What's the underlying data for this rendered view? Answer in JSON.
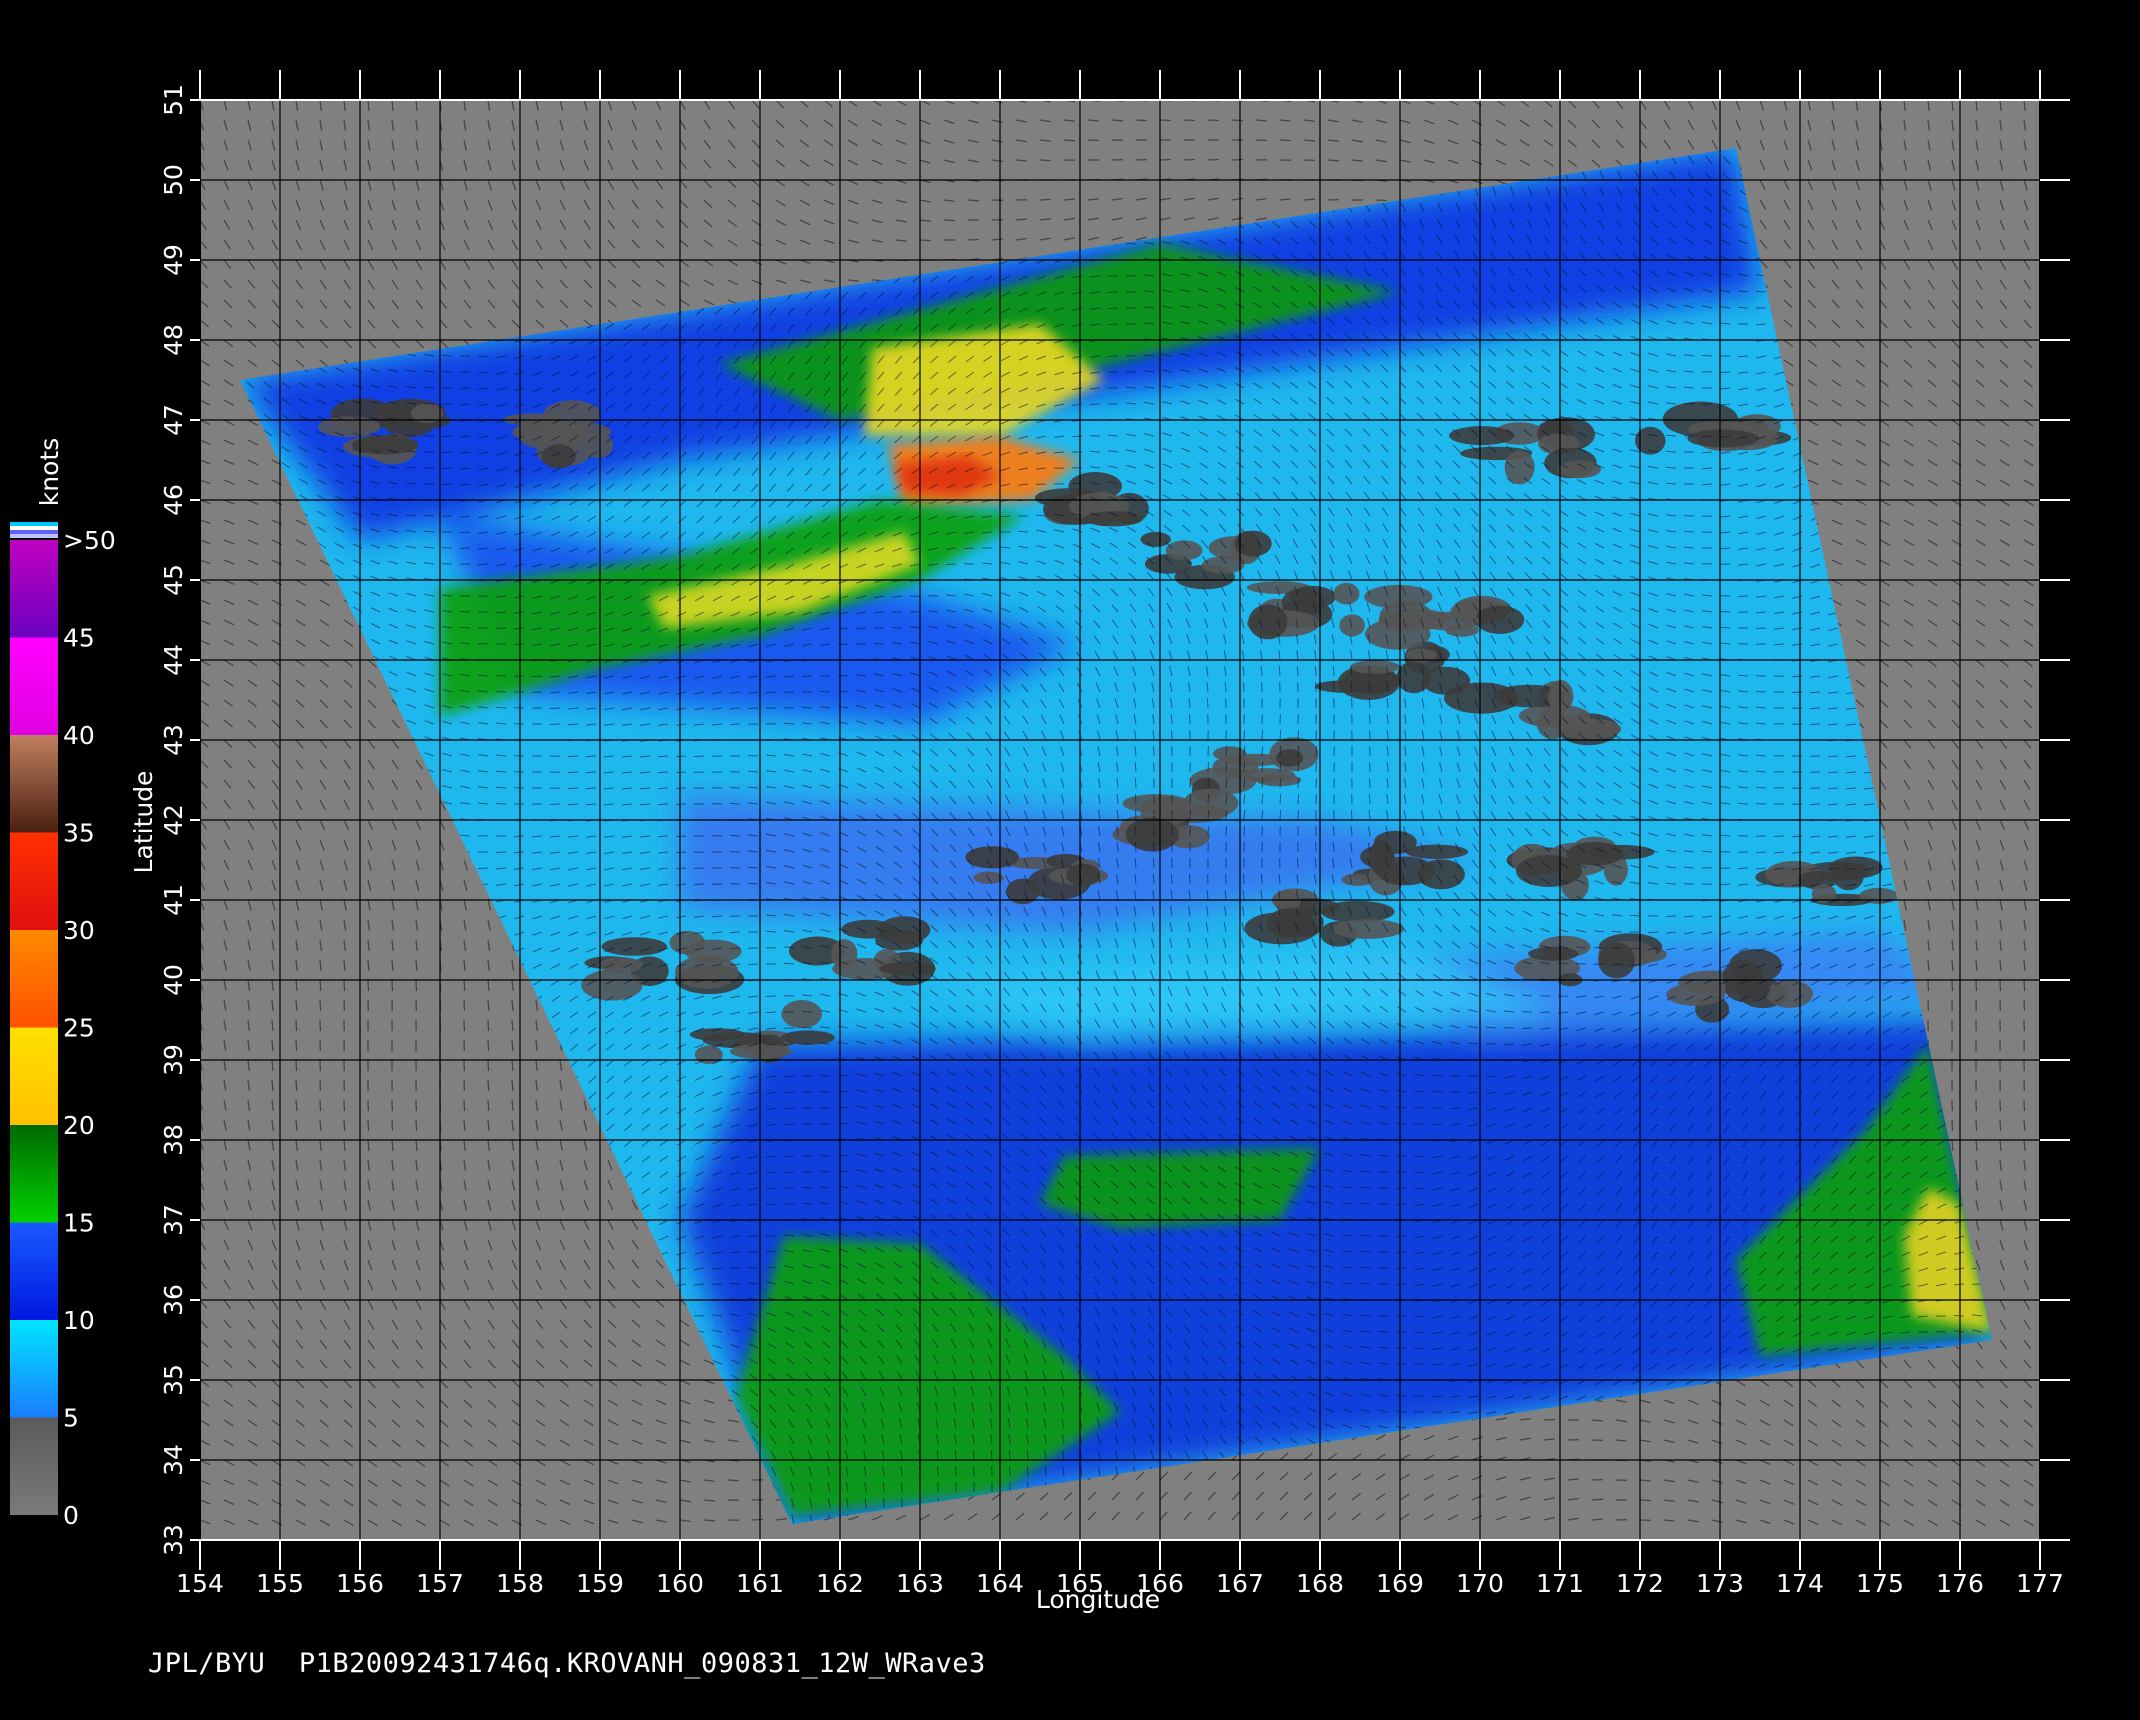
{
  "figure": {
    "footer_source": "JPL/BYU",
    "footer_file": "P1B20092431746q.KROVANH_090831_12W_WRave3",
    "xlabel": "Longitude",
    "ylabel": "Latitude",
    "colorbar_units": "knots"
  },
  "axes": {
    "lon_ticks": [
      "154",
      "155",
      "156",
      "157",
      "158",
      "159",
      "160",
      "161",
      "162",
      "163",
      "164",
      "165",
      "166",
      "167",
      "168",
      "169",
      "170",
      "171",
      "172",
      "173",
      "174",
      "175",
      "176",
      "177"
    ],
    "lat_ticks": [
      "33",
      "34",
      "35",
      "36",
      "37",
      "38",
      "39",
      "40",
      "41",
      "42",
      "43",
      "44",
      "45",
      "46",
      "47",
      "48",
      "49",
      "50",
      "51"
    ],
    "lon_range": [
      154,
      177
    ],
    "lat_range": [
      33,
      51
    ]
  },
  "colorbar": {
    "labels": [
      "0",
      "5",
      "10",
      "15",
      "20",
      "25",
      "30",
      "35",
      "40",
      "45",
      ">50"
    ],
    "stops": [
      {
        "from": 0,
        "to": 5,
        "color": "#5a5a5a",
        "color2": "#7a7a7a"
      },
      {
        "from": 5,
        "to": 10,
        "color": "#00e5ff",
        "color2": "#1a7dff"
      },
      {
        "from": 10,
        "to": 15,
        "color": "#1a5aff",
        "color2": "#0018e0"
      },
      {
        "from": 15,
        "to": 20,
        "color": "#006a00",
        "color2": "#00d000"
      },
      {
        "from": 20,
        "to": 25,
        "color": "#ffe000",
        "color2": "#ffc000"
      },
      {
        "from": 25,
        "to": 30,
        "color": "#ff8a00",
        "color2": "#ff5000"
      },
      {
        "from": 30,
        "to": 35,
        "color": "#ff3000",
        "color2": "#e01010"
      },
      {
        "from": 35,
        "to": 40,
        "color": "#c08060",
        "color2": "#4a2010"
      },
      {
        "from": 40,
        "to": 45,
        "color": "#ff00ff",
        "color2": "#e000e0"
      },
      {
        "from": 45,
        "to": 50,
        "color": "#c000c0",
        "color2": "#6a00c0"
      }
    ]
  },
  "swath": {
    "corners_lonlat": [
      [
        154.5,
        47.5
      ],
      [
        173.2,
        50.4
      ],
      [
        176.4,
        35.5
      ],
      [
        161.4,
        33.2
      ]
    ],
    "background_color": "#808080",
    "grid_color": "#000000"
  },
  "wind_regions": [
    {
      "name": "north-green-band",
      "speed": "15-20",
      "color": "#0a9a0a",
      "poly": [
        [
          160.5,
          47.7
        ],
        [
          166,
          49.2
        ],
        [
          169,
          48.6
        ],
        [
          165,
          47.6
        ],
        [
          162,
          47
        ]
      ]
    },
    {
      "name": "storm-core-yellow",
      "speed": "20-25",
      "color": "#e8d820",
      "poly": [
        [
          162.4,
          47.9
        ],
        [
          164.5,
          48.2
        ],
        [
          165.3,
          47.5
        ],
        [
          164,
          46.8
        ],
        [
          162.3,
          46.8
        ]
      ]
    },
    {
      "name": "storm-core-orange",
      "speed": "25-30",
      "color": "#ff7a10",
      "poly": [
        [
          162.6,
          46.7
        ],
        [
          164,
          46.8
        ],
        [
          165,
          46.5
        ],
        [
          164.4,
          46.0
        ],
        [
          162.8,
          45.9
        ]
      ]
    },
    {
      "name": "storm-core-red",
      "speed": "30-35",
      "color": "#e03010",
      "poly": [
        [
          162.7,
          46.45
        ],
        [
          163.6,
          46.55
        ],
        [
          164.0,
          46.3
        ],
        [
          163.5,
          46.05
        ],
        [
          162.8,
          46.1
        ]
      ]
    },
    {
      "name": "west-green-band",
      "speed": "15-20",
      "color": "#10a010",
      "poly": [
        [
          157,
          44.9
        ],
        [
          160,
          45.3
        ],
        [
          162.5,
          46.0
        ],
        [
          164.3,
          45.8
        ],
        [
          163,
          45
        ],
        [
          161,
          44.3
        ],
        [
          159,
          43.9
        ],
        [
          157,
          43.3
        ]
      ]
    },
    {
      "name": "west-yellow-patches",
      "speed": "20-25",
      "color": "#d8d820",
      "poly": [
        [
          159.6,
          44.8
        ],
        [
          161.4,
          45.2
        ],
        [
          162.8,
          45.6
        ],
        [
          163,
          45.2
        ],
        [
          161.5,
          44.6
        ],
        [
          159.8,
          44.4
        ]
      ]
    },
    {
      "name": "south-green-west",
      "speed": "15-20",
      "color": "#10a010",
      "poly": [
        [
          161.3,
          36.8
        ],
        [
          163,
          36.7
        ],
        [
          164.8,
          35.3
        ],
        [
          165.5,
          34.6
        ],
        [
          164,
          33.6
        ],
        [
          161.4,
          33.3
        ],
        [
          160.7,
          34.8
        ]
      ]
    },
    {
      "name": "south-green-mid",
      "speed": "15-20",
      "color": "#109a10",
      "poly": [
        [
          164.8,
          37.8
        ],
        [
          168,
          37.9
        ],
        [
          167.5,
          37.0
        ],
        [
          165.5,
          36.9
        ],
        [
          164.5,
          37.2
        ]
      ]
    },
    {
      "name": "south-east-green",
      "speed": "15-20",
      "color": "#10a010",
      "poly": [
        [
          174.8,
          38.1
        ],
        [
          175.6,
          39.2
        ],
        [
          176.4,
          35.6
        ],
        [
          173.5,
          35.3
        ],
        [
          173.2,
          36.5
        ]
      ]
    },
    {
      "name": "south-east-yellow",
      "speed": "20-25",
      "color": "#e0d020",
      "poly": [
        [
          175.6,
          37.4
        ],
        [
          176.0,
          37.2
        ],
        [
          176.4,
          35.6
        ],
        [
          175.4,
          35.8
        ],
        [
          175.3,
          36.8
        ]
      ]
    }
  ],
  "calm_patches": [
    [
      156.4,
      46.9
    ],
    [
      158.5,
      46.8
    ],
    [
      165.2,
      46.0
    ],
    [
      166.5,
      45.3
    ],
    [
      167.8,
      44.7
    ],
    [
      168.9,
      43.9
    ],
    [
      169.6,
      44.6
    ],
    [
      170.7,
      43.3
    ],
    [
      167.2,
      42.6
    ],
    [
      166.0,
      42.0
    ],
    [
      169.1,
      41.5
    ],
    [
      171.3,
      41.4
    ],
    [
      174.3,
      41.2
    ],
    [
      172.8,
      47.0
    ],
    [
      170.6,
      46.6
    ],
    [
      159.8,
      40.2
    ],
    [
      161.0,
      39.3
    ],
    [
      164.5,
      41.3
    ],
    [
      168.0,
      40.8
    ],
    [
      171.5,
      40.2
    ],
    [
      162.2,
      40.4
    ],
    [
      173.3,
      39.9
    ]
  ]
}
